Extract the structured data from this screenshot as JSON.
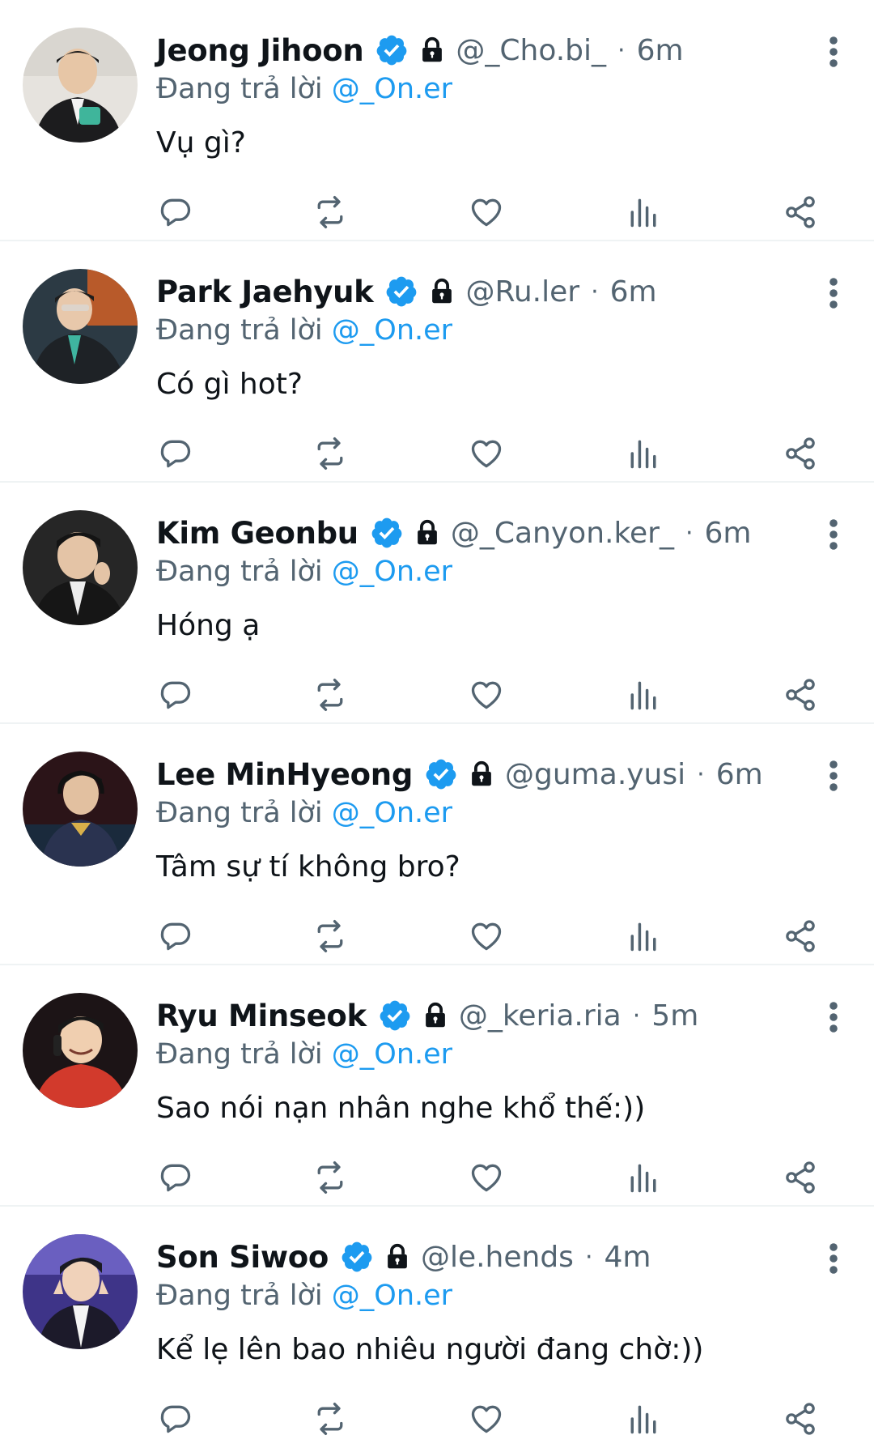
{
  "colors": {
    "accent": "#1d9bf0",
    "text": "#0f1419",
    "muted": "#536471",
    "divider": "#eff3f4"
  },
  "labels": {
    "replying_to": "Đang trả lời",
    "dot": "·"
  },
  "icons": {
    "verified": "verified-badge-icon",
    "lock": "protected-lock-icon",
    "more": "more-vertical-icon",
    "reply": "reply-icon",
    "retweet": "retweet-icon",
    "like": "heart-icon",
    "views": "views-icon",
    "share": "share-icon"
  },
  "tweets": [
    {
      "name": "Jeong Jihoon",
      "handle": "@_Cho.bi_",
      "time": "6m",
      "reply_to": "@_On.er",
      "text": "Vụ gì?",
      "avatar_color": "#cfcac2"
    },
    {
      "name": "Park Jaehyuk",
      "handle": "@Ru.ler",
      "time": "6m",
      "reply_to": "@_On.er",
      "text": "Có gì hot?",
      "avatar_color": "#3a4a55"
    },
    {
      "name": "Kim Geonbu",
      "handle": "@_Canyon.ker_",
      "time": "6m",
      "reply_to": "@_On.er",
      "text": "Hóng ạ",
      "avatar_color": "#2a2a2a"
    },
    {
      "name": "Lee MinHyeong",
      "handle": "@guma.yusi",
      "time": "6m",
      "reply_to": "@_On.er",
      "text": "Tâm sự tí không bro?",
      "avatar_color": "#3a1f22"
    },
    {
      "name": "Ryu Minseok",
      "handle": "@_keria.ria",
      "time": "5m",
      "reply_to": "@_On.er",
      "text": "Sao nói nạn nhân nghe khổ thế:))",
      "avatar_color": "#c0392b"
    },
    {
      "name": "Son Siwoo",
      "handle": "@le.hends",
      "time": "4m",
      "reply_to": "@_On.er",
      "text": "Kể lẹ lên bao nhiêu người đang chờ:))",
      "avatar_color": "#4b3d8f"
    }
  ]
}
